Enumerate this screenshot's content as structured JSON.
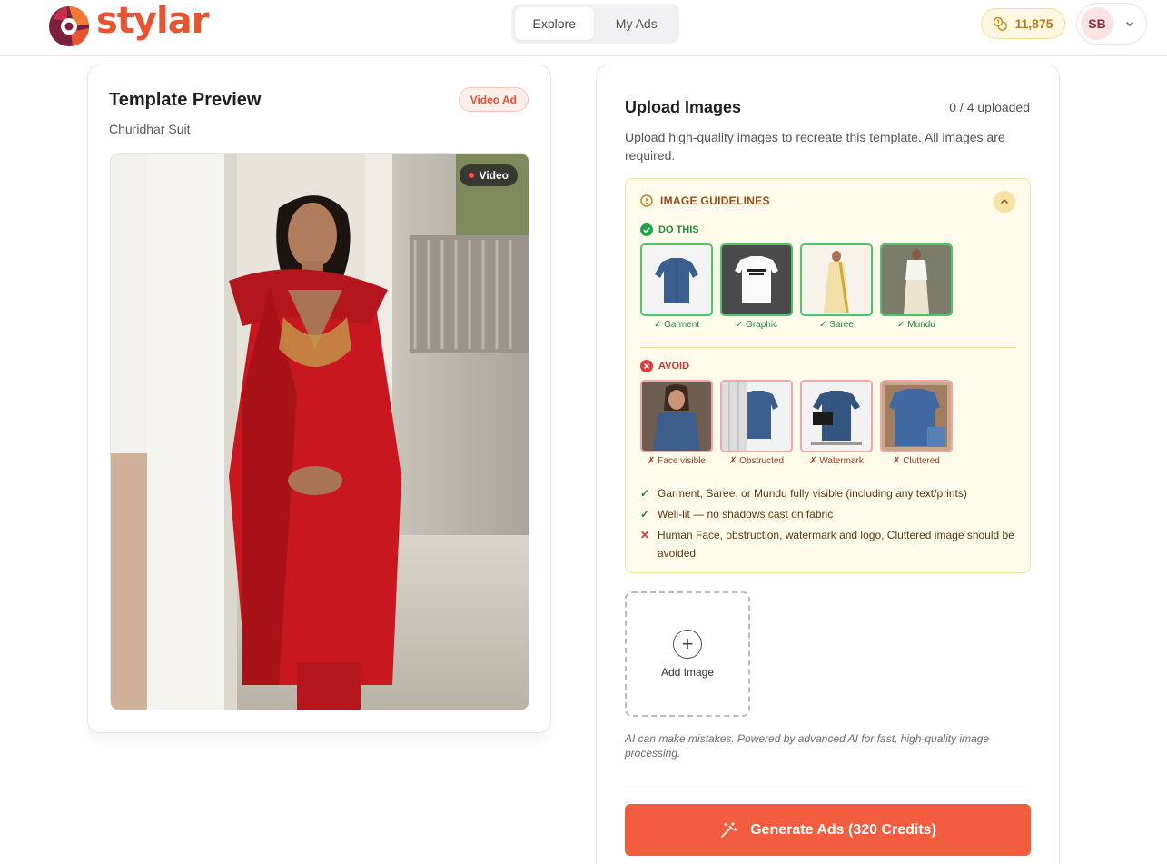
{
  "brand": {
    "name": "stylar",
    "accent": "#f25c3f"
  },
  "nav": {
    "tabs": [
      {
        "label": "Explore",
        "active": true
      },
      {
        "label": "My Ads",
        "active": false
      }
    ]
  },
  "credits": {
    "value": "11,875",
    "icon": "coins-icon"
  },
  "user": {
    "initials": "SB"
  },
  "template": {
    "title": "Template Preview",
    "badge": "Video Ad",
    "name": "Churidhar Suit",
    "video_label": "Video"
  },
  "upload": {
    "title": "Upload Images",
    "count": "0 / 4 uploaded",
    "description": "Upload high-quality images to recreate this template. All images are required.",
    "add_label": "Add Image",
    "disclaimer": "AI can make mistakes. Powered by advanced AI for fast, high-quality image processing.",
    "generate_label": "Generate Ads (320 Credits)"
  },
  "guidelines": {
    "title": "IMAGE GUIDELINES",
    "do_title": "DO THIS",
    "avoid_title": "AVOID",
    "do_items": [
      "✓ Garment",
      "✓ Graphic",
      "✓ Saree",
      "✓ Mundu"
    ],
    "avoid_items": [
      "✗ Face visible",
      "✗ Obstructed",
      "✗ Watermark",
      "✗ Cluttered"
    ],
    "rules": [
      {
        "type": "ok",
        "text": "Garment, Saree, or Mundu fully visible (including any text/prints)"
      },
      {
        "type": "ok",
        "text": "Well-lit — no shadows cast on fabric"
      },
      {
        "type": "no",
        "text": "Human Face, obstruction, watermark and logo, Cluttered image should be avoided"
      }
    ]
  }
}
